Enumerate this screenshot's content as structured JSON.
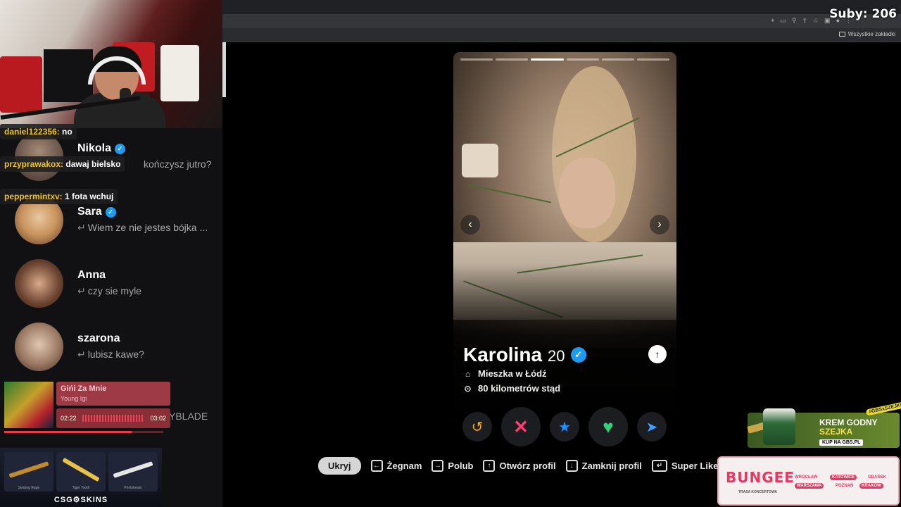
{
  "overlay": {
    "subs_label": "Suby: 206"
  },
  "browser": {
    "bookmarks_label": "Wszystkie zakładki",
    "toolbar_icons": [
      "location-icon",
      "cast-icon",
      "zoom-icon",
      "share-icon",
      "star-icon",
      "extensions-icon",
      "profile-icon",
      "menu-icon"
    ]
  },
  "chat_overlay": [
    {
      "user": "daniel122356:",
      "message": " no"
    },
    {
      "user": "przyprawakox:",
      "message": " dawaj bielsko"
    },
    {
      "user": "peppermintxv:",
      "message": " 1 fota wchuj"
    }
  ],
  "conversations": [
    {
      "name": "Nikola",
      "verified": true,
      "preview": "kończysz jutro?"
    },
    {
      "name": "Sara",
      "verified": true,
      "preview": "Wiem ze nie jestes bójka ..."
    },
    {
      "name": "Anna",
      "verified": false,
      "preview": "czy sie myle"
    },
    {
      "name": "szarona",
      "verified": false,
      "preview": "lubisz kawe?"
    }
  ],
  "now_playing": {
    "title": "Gińi Za Mnie",
    "artist": "Young Igi",
    "elapsed": "02:22",
    "duration": "03:02",
    "progress": 0.8,
    "behind_text": "YBLADE"
  },
  "csgo_ad": {
    "title": "CSG⚙SKINS",
    "items": [
      "Searing Rage",
      "Tiger Tooth",
      "Printstream"
    ]
  },
  "profile": {
    "name": "Karolina",
    "age": "20",
    "verified": true,
    "city": "Mieszka w Łódź",
    "distance": "80 kilometrów stąd",
    "photo_count": 6,
    "active_photo": 3
  },
  "actions": {
    "rewind_color": "#f5a623",
    "nope_color": "#fe3c72",
    "superlike_color": "#1e90ff",
    "like_color": "#33d27a",
    "boost_color": "#3aa0ff"
  },
  "hints": {
    "hide_label": "Ukryj",
    "nope_label": "Żegnam",
    "like_label": "Polub",
    "open_profile_label": "Otwórz profil",
    "close_profile_label": "Zamknij profil",
    "superlike_label": "Super Like"
  },
  "ads": {
    "krem_title": "KREM GODNY",
    "krem_sub": "SZEJKA",
    "krem_cta": "KUP NA GBS.PL",
    "krem_badge": "#GBSxSZEJKI",
    "bungee_logo": "BUNGEE",
    "bungee_sub": "TRASA KONCERTOWA",
    "cities": [
      "WROCŁAW",
      "KATOWICE",
      "GDAŃSK",
      "WARSZAWA",
      "POZNAŃ",
      "KRAKÓW"
    ]
  }
}
